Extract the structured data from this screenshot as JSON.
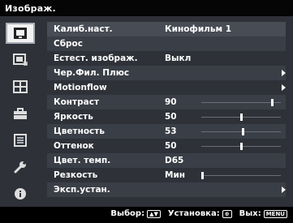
{
  "window": {
    "title": "Изображ."
  },
  "sidebar": {
    "tabs": [
      {
        "icon": "picture-icon",
        "selected": true
      },
      {
        "icon": "screen-adjust-icon",
        "selected": false
      },
      {
        "icon": "grid-icon",
        "selected": false
      },
      {
        "icon": "briefcase-icon",
        "selected": false
      },
      {
        "icon": "list-icon",
        "selected": false
      },
      {
        "icon": "wrench-icon",
        "selected": false
      },
      {
        "icon": "info-icon",
        "selected": false
      }
    ]
  },
  "menu": {
    "items": [
      {
        "label": "Калиб.наст.",
        "value": "Кинофильм 1"
      },
      {
        "label": "Сброс"
      },
      {
        "label": "Естест. изображ.",
        "value": "Выкл"
      },
      {
        "label": "Чер.Фил. Плюс",
        "submenu": true
      },
      {
        "label": "Motionflow",
        "submenu": true
      },
      {
        "label": "Контраст",
        "value": "90",
        "level": 90,
        "max": 100
      },
      {
        "label": "Яркость",
        "value": "50",
        "level": 50,
        "max": 100
      },
      {
        "label": "Цветность",
        "value": "53",
        "level": 53,
        "max": 100
      },
      {
        "label": "Оттенок",
        "value": "50",
        "level": 50,
        "max": 100
      },
      {
        "label": "Цвет. темп.",
        "value": "D65"
      },
      {
        "label": "Резкость",
        "value": "Мин",
        "level": 0,
        "max": 100
      },
      {
        "label": "Эксп.устан.",
        "submenu": true
      }
    ]
  },
  "footer": {
    "select_label": "Выбор:",
    "set_label": "Установка:",
    "exit_label": "Вых:",
    "menu_key": "MENU"
  },
  "colors": {
    "panel": "#2e3138",
    "selected_row": "#474c55",
    "tab_selected": "#f2f2f2"
  }
}
